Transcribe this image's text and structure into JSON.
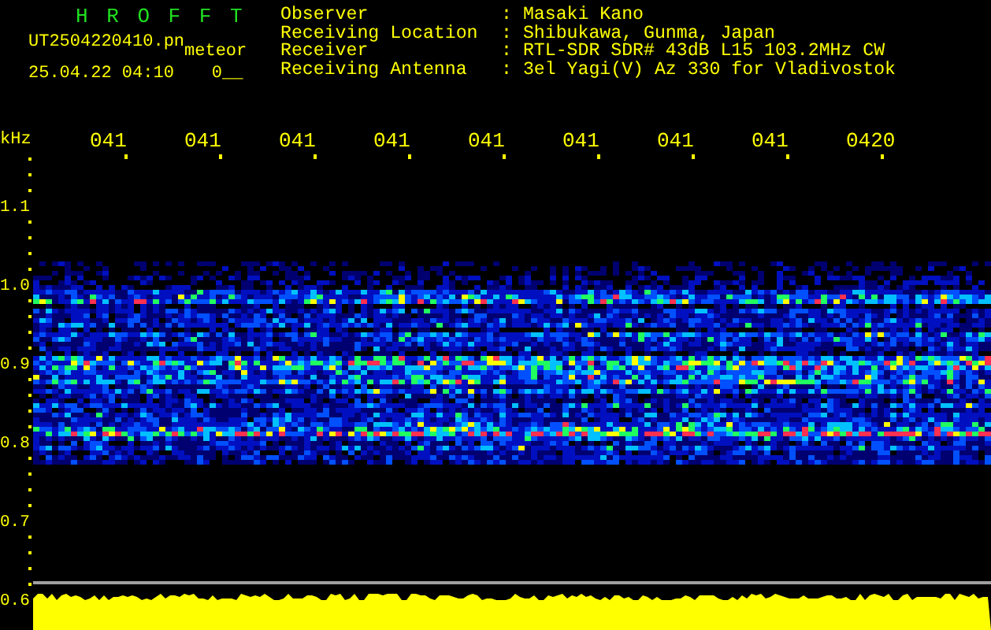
{
  "title": "H R O F F T",
  "file_name": "UT2504220410.pn",
  "mode": "meteor",
  "timestamp": "25.04.22 04:10",
  "counter": "0__",
  "station_info": [
    {
      "label": "Observer",
      "separator": ":",
      "value": "Masaki Kano"
    },
    {
      "label": "Receiving Location",
      "separator": ":",
      "value": "Shibukawa, Gunma, Japan"
    },
    {
      "label": "Receiver",
      "separator": ":",
      "value": "RTL-SDR SDR# 43dB L15 103.2MHz CW"
    },
    {
      "label": "Receiving Antenna",
      "separator": ":",
      "value": "3el Yagi(V) Az 330 for Vladivostok"
    }
  ],
  "spectrogram": {
    "y_unit": "kHz",
    "y_labels": [
      "1.1",
      "1.0",
      "0.9",
      "0.8",
      "0.7",
      "0.6"
    ],
    "time_labels": [
      "041",
      "041",
      "041",
      "041",
      "041",
      "041",
      "041",
      "041",
      "0420"
    ]
  }
}
